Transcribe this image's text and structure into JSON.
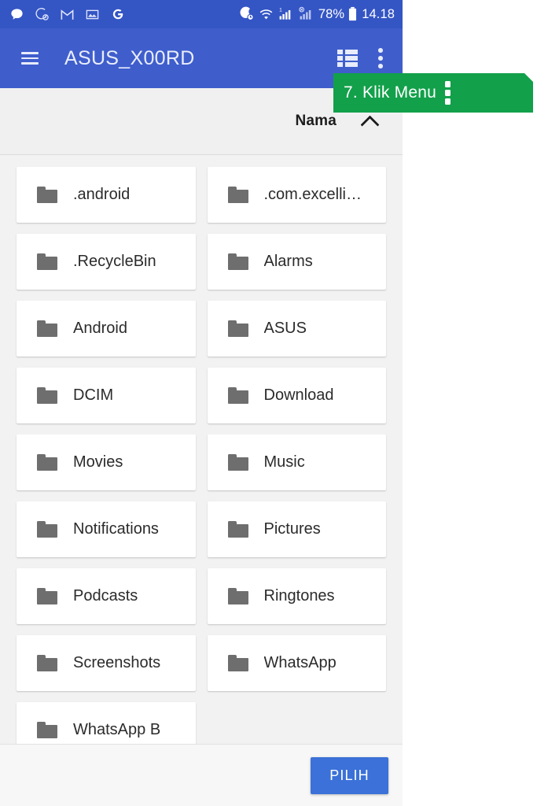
{
  "statusbar": {
    "left_icons": [
      "chat-bubble-icon",
      "do-not-disturb-moon-icon",
      "gmail-icon",
      "photo-icon",
      "google-icon"
    ],
    "right_icons": [
      "do-not-disturb-moon-icon",
      "wifi-icon",
      "signal-bars-sim1-icon",
      "signal-bars-sim2-disabled-icon"
    ],
    "battery_percent": "78%",
    "battery_icon": "battery-icon",
    "time": "14.18"
  },
  "appbar": {
    "menu_icon": "hamburger-menu-icon",
    "title": "ASUS_X00RD",
    "listview_icon": "list-view-icon",
    "overflow_icon": "overflow-menu-icon"
  },
  "sortbar": {
    "label": "Nama",
    "direction_icon": "chevron-up-icon"
  },
  "callout": {
    "text": "7. Klik Menu",
    "icon": "overflow-menu-icon",
    "color": "#12a04a"
  },
  "files": {
    "icon": "folder-icon",
    "items": [
      ".android",
      ".com.excelli…",
      ".RecycleBin",
      "Alarms",
      "Android",
      "ASUS",
      "DCIM",
      "Download",
      "Movies",
      "Music",
      "Notifications",
      "Pictures",
      "Podcasts",
      "Ringtones",
      "Screenshots",
      "WhatsApp",
      "WhatsApp B"
    ]
  },
  "bottombar": {
    "select_label": "PILIH",
    "accent_color": "#3b71d8"
  }
}
